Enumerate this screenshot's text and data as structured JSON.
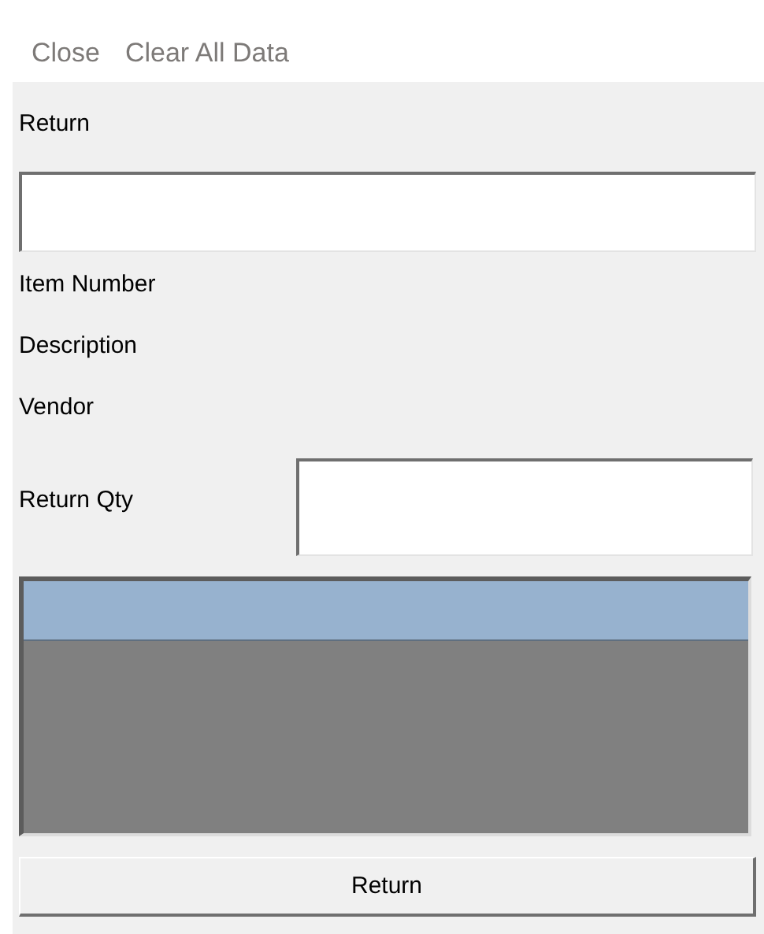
{
  "menu": [
    {
      "label": "Close",
      "disabled": true
    },
    {
      "label": "Clear All Data",
      "disabled": true
    }
  ],
  "form": {
    "title": "Return",
    "info_labels": [
      "Item Number",
      "Description",
      "Vendor"
    ],
    "qty_label": "Return Qty",
    "grid": {
      "rows": [
        {
          "selected": true
        }
      ]
    },
    "button": "Return"
  }
}
